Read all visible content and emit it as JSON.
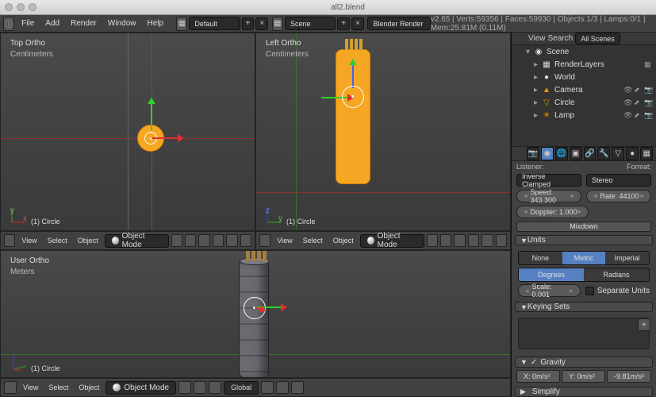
{
  "window_title": "all2.blend",
  "top_menu": [
    "File",
    "Add",
    "Render",
    "Window",
    "Help"
  ],
  "screen_layout": "Default",
  "scene_name": "Scene",
  "render_engine": "Blender Render",
  "version": "v2.65",
  "stats": "Verts:59356 | Faces:59930 | Objects:1/3 | Lamps:0/1 | Mem:25.81M (0.11M)",
  "viewports": {
    "top_left": {
      "view": "Top Ortho",
      "units": "Centimeters",
      "object": "(1) Circle"
    },
    "top_right": {
      "view": "Left Ortho",
      "units": "Centimeters",
      "object": "(1) Circle"
    },
    "bottom": {
      "view": "User Ortho",
      "units": "Meters",
      "object": "(1) Circle"
    }
  },
  "vp_header_menus": [
    "View",
    "Select",
    "Object"
  ],
  "vp_mode": "Object Mode",
  "vp_orientation": "Global",
  "outliner": {
    "header_view": "View",
    "header_search": "Search",
    "filter": "All Scenes",
    "tree": {
      "scene": "Scene",
      "renderlayers": "RenderLayers",
      "world": "World",
      "camera": "Camera",
      "circle": "Circle",
      "lamp": "Lamp"
    }
  },
  "properties": {
    "audio": {
      "listener_label": "Listener:",
      "format_label": "Format:",
      "listener": "Inverse Clamped",
      "format": "Stereo",
      "speed_label": "Speed: 343.300",
      "rate_label": "Rate: 44100",
      "doppler_label": "Doppler: 1.000",
      "mixdown": "Mixdown"
    },
    "units": {
      "header": "Units",
      "none": "None",
      "metric": "Metric",
      "imperial": "Imperial",
      "degrees": "Degrees",
      "radians": "Radians",
      "scale": "Scale: 0.001",
      "separate": "Separate Units"
    },
    "keying": {
      "header": "Keying Sets"
    },
    "gravity": {
      "header": "Gravity",
      "x": "X: 0m/s²",
      "y": "Y: 0m/s²",
      "z": "-9.81m/s²"
    },
    "simplify": {
      "header": "Simplify"
    }
  }
}
